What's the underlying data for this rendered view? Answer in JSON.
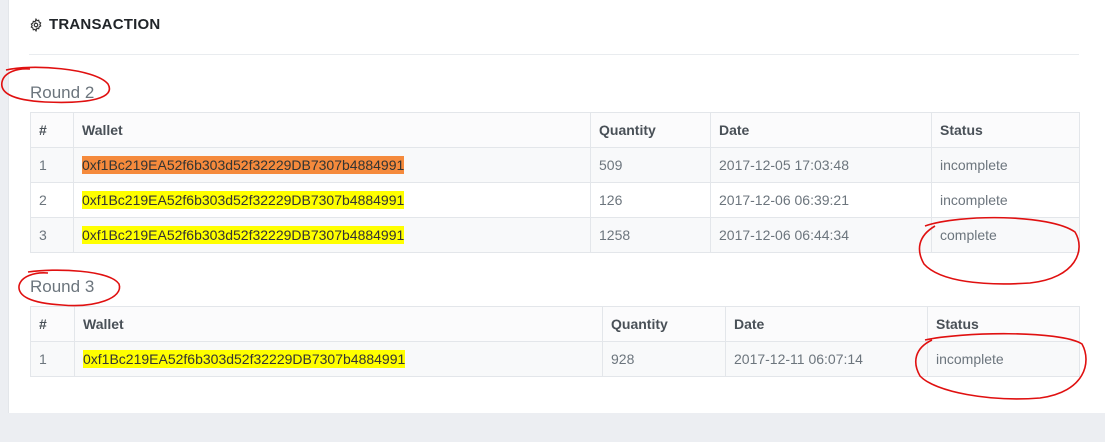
{
  "panel": {
    "title": "TRANSACTION",
    "icon": "gear-icon"
  },
  "columns": [
    "#",
    "Wallet",
    "Quantity",
    "Date",
    "Status"
  ],
  "rounds": [
    {
      "title": "Round 2",
      "rows": [
        {
          "num": "1",
          "wallet": "0xf1Bc219EA52f6b303d52f32229DB7307b4884991",
          "quantity": "509",
          "date": "2017-12-05 17:03:48",
          "status": "incomplete",
          "highlight": "#f58a3c"
        },
        {
          "num": "2",
          "wallet": "0xf1Bc219EA52f6b303d52f32229DB7307b4884991",
          "quantity": "126",
          "date": "2017-12-06 06:39:21",
          "status": "incomplete",
          "highlight": "#ffff00"
        },
        {
          "num": "3",
          "wallet": "0xf1Bc219EA52f6b303d52f32229DB7307b4884991",
          "quantity": "1258",
          "date": "2017-12-06 06:44:34",
          "status": "complete",
          "highlight": "#ffff00"
        }
      ]
    },
    {
      "title": "Round 3",
      "rows": [
        {
          "num": "1",
          "wallet": "0xf1Bc219EA52f6b303d52f32229DB7307b4884991",
          "quantity": "928",
          "date": "2017-12-11 06:07:14",
          "status": "incomplete",
          "highlight": "#ffff00"
        }
      ]
    }
  ],
  "annotation_color": "#e01010"
}
